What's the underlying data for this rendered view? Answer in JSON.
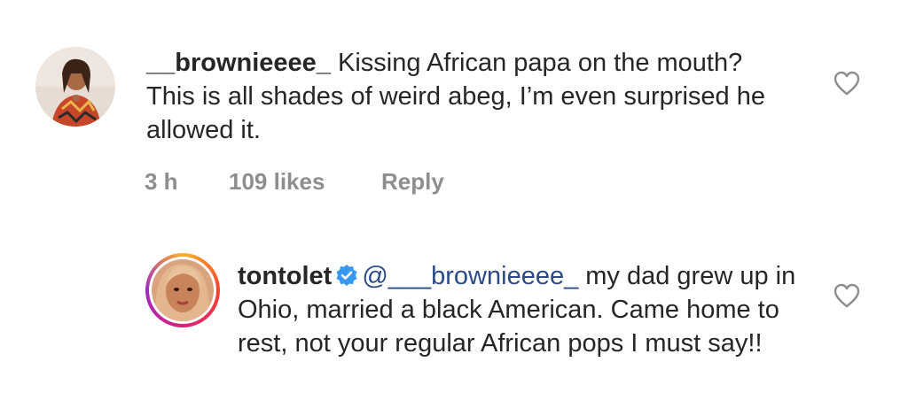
{
  "comments": [
    {
      "username": "__brownieeee_",
      "text": " Kissing African papa on the mouth? This is all shades of weird abeg, I’m even surprised he allowed it.",
      "time": "3 h",
      "likes": "109 likes",
      "reply_label": "Reply",
      "avatar_icon": "user-avatar"
    },
    {
      "username": "tontolet",
      "mention": "@___brownieeee_",
      "text": " my dad grew up in Ohio, married a black American. Came home to rest, not your regular African pops I must say!!",
      "verified": true,
      "avatar_icon": "user-avatar-story-ring"
    }
  ],
  "colors": {
    "text": "#262626",
    "meta": "#8e8e8e",
    "mention": "#2b4a86",
    "verified": "#3897f0",
    "heart": "#8e8e8e"
  }
}
